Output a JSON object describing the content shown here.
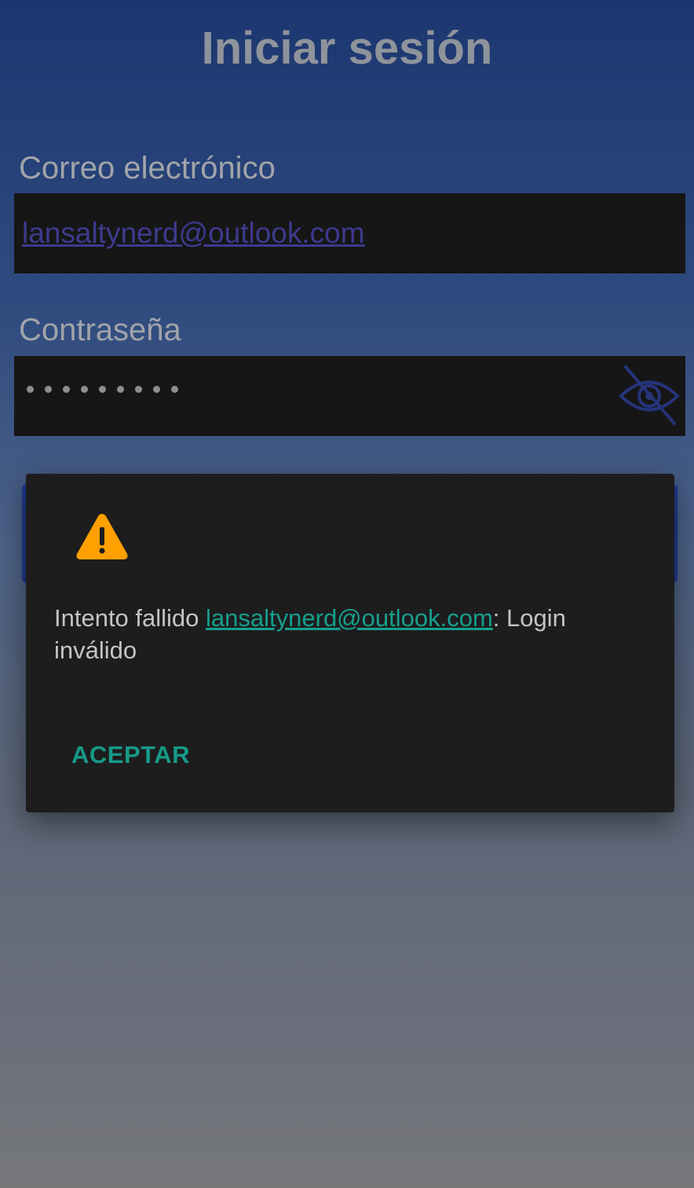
{
  "header": {
    "title": "Iniciar sesión"
  },
  "form": {
    "email": {
      "label": "Correo electrónico",
      "value": "lansaltynerd@outlook.com"
    },
    "password": {
      "label": "Contraseña",
      "masked_length": 9,
      "visibility_icon": "eye-off-icon"
    }
  },
  "dialog": {
    "icon": "warning-icon",
    "message_prefix": "Intento fallido ",
    "message_link": "lansaltynerd@outlook.com",
    "message_suffix": ": Login inválido",
    "accept_label": "ACEPTAR"
  },
  "colors": {
    "accent": "#169a88",
    "warning": "#ffa000",
    "link_email": "#3e3a8e"
  }
}
